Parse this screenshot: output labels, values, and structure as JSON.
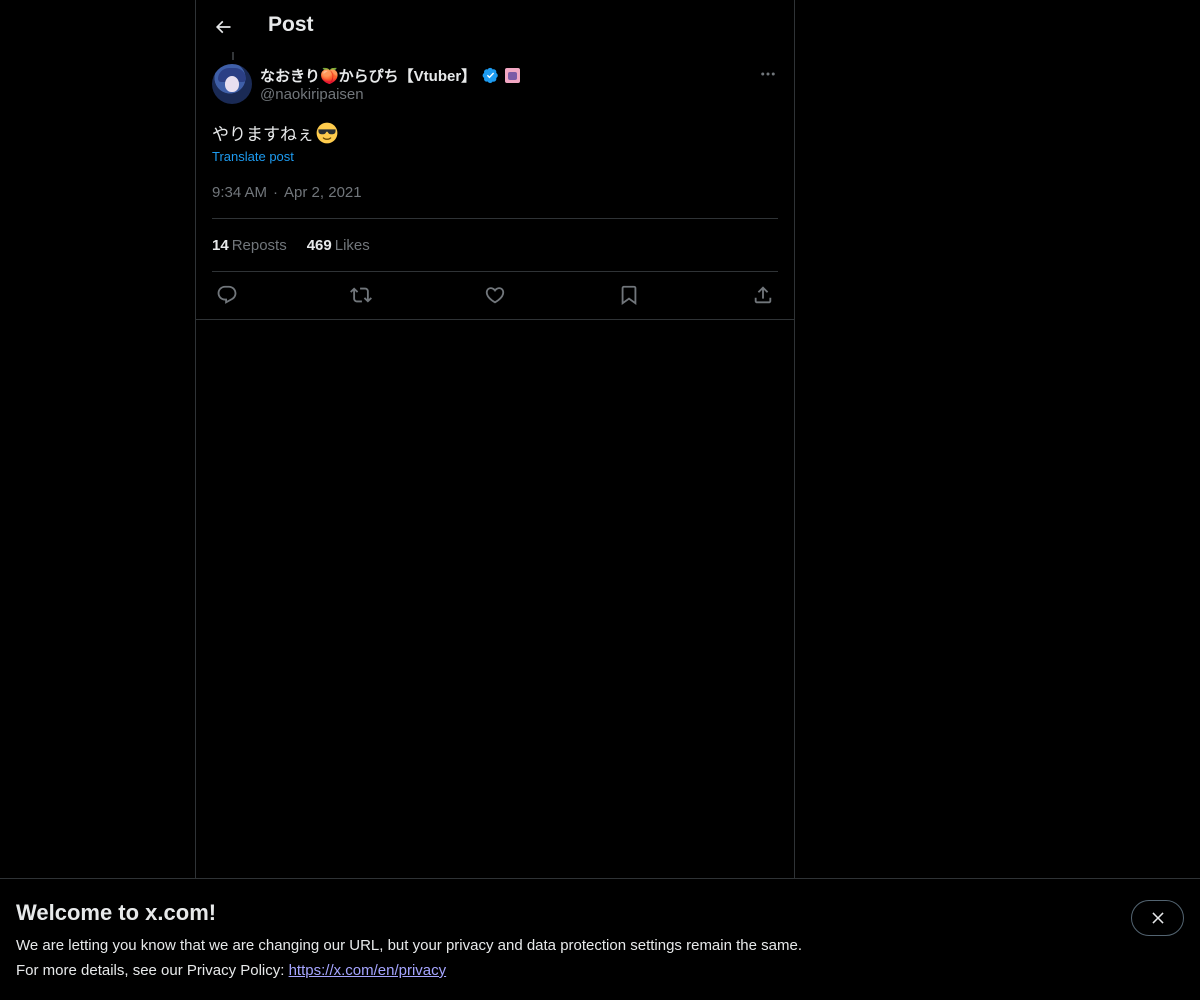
{
  "header": {
    "title": "Post",
    "back_icon": "arrow-left-icon"
  },
  "post": {
    "author": {
      "display_name": "なおきり🍑からぴち【Vtuber】",
      "handle": "@naokiripaisen",
      "verified": true,
      "verified_color": "#1d9bf0"
    },
    "text": "やりますねぇ",
    "emoji": "smiling-face-with-sunglasses",
    "translate_label": "Translate post",
    "time": "9:34 AM",
    "separator": "·",
    "date": "Apr 2, 2021",
    "stats": {
      "reposts_count": "14",
      "reposts_label": "Reposts",
      "likes_count": "469",
      "likes_label": "Likes"
    },
    "actions": [
      "reply-icon",
      "repost-icon",
      "like-icon",
      "bookmark-icon",
      "share-icon"
    ]
  },
  "banner": {
    "title": "Welcome to x.com!",
    "line1": "We are letting you know that we are changing our URL, but your privacy and data protection settings remain the same.",
    "line2_prefix": "For more details, see our Privacy Policy: ",
    "link": "https://x.com/en/privacy",
    "close_icon": "close-icon"
  },
  "colors": {
    "background": "#000000",
    "text_primary": "#e7e9ea",
    "text_secondary": "#71767b",
    "accent": "#1d9bf0",
    "border": "#2f3336",
    "link_banner": "#a5a5ff"
  }
}
